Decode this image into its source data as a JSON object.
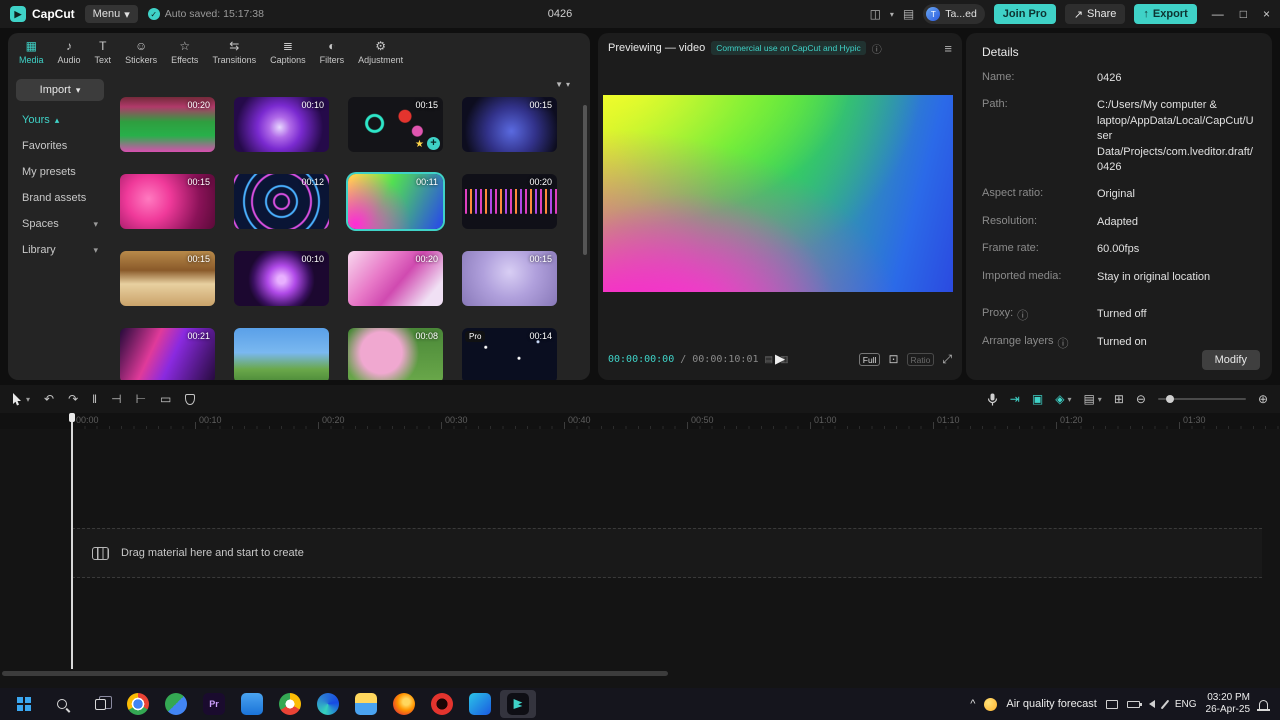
{
  "accent": "#3fd2c7",
  "icons": {
    "check": "✓",
    "chevron_down": "▾",
    "chevron_up": "▴",
    "share_arrow": "↗",
    "export_arrow": "↑",
    "minimize": "—",
    "maximize": "□",
    "close": "×",
    "hamburger": "≡",
    "info": "ⓘ",
    "play": "▶",
    "undo": "↶",
    "redo": "↷",
    "split": "‖",
    "trim_left": "⊣",
    "trim_right": "⊢",
    "delete": "▭",
    "zoom_out": "⊖",
    "zoom_in": "⊕",
    "crop": "⊡",
    "expand": "⤢",
    "filter": "▼",
    "star": "★",
    "plus": "+",
    "layout": "◫",
    "keyboard": "▤",
    "magnet": "⇥",
    "link": "▣",
    "keyframe": "◈",
    "tracks": "▤",
    "screen": "⊞",
    "caret_up": "^",
    "grid_a": "▤",
    "grid_b": "▥",
    "logo_play": "▶"
  },
  "titlebar": {
    "app_name": "CapCut",
    "menu_label": "Menu",
    "autosave_text": "Auto saved: 15:17:38",
    "project_title": "0426",
    "user_initial": "T",
    "user_name": "Ta...ed",
    "join_pro_label": "Join Pro",
    "share_label": "Share",
    "export_label": "Export"
  },
  "media_tabs": [
    {
      "label": "Media",
      "icon": "▦"
    },
    {
      "label": "Audio",
      "icon": "♪"
    },
    {
      "label": "Text",
      "icon": "T"
    },
    {
      "label": "Stickers",
      "icon": "☺"
    },
    {
      "label": "Effects",
      "icon": "☆"
    },
    {
      "label": "Transitions",
      "icon": "⇆"
    },
    {
      "label": "Captions",
      "icon": "≣"
    },
    {
      "label": "Filters",
      "icon": "◐"
    },
    {
      "label": "Adjustment",
      "icon": "⚙"
    }
  ],
  "sidebar": {
    "import_label": "Import",
    "yours_label": "Yours",
    "favorites_label": "Favorites",
    "presets_label": "My presets",
    "brand_label": "Brand assets",
    "spaces_label": "Spaces",
    "library_label": "Library"
  },
  "media_grid": {
    "items": [
      {
        "name": "stadium-clip",
        "duration": "00:20",
        "bg": "background:linear-gradient(180deg,#742a3a 0%,#b03a6a 18%,#2f9e3f 45%,#27b04a 70%,#d84fb0 100%)"
      },
      {
        "name": "purple-flare-clip",
        "duration": "00:10",
        "bg": "background:radial-gradient(circle at 48% 55%,#e8d8ff 0%,#b06ae8 18%,#7a2ad0 38%,#250a4a 75%)"
      },
      {
        "name": "neon-circles-clip",
        "duration": "00:15",
        "bg": "background:radial-gradient(circle at 28% 48%,rgba(0,0,0,0) 0 6px,#2ee6c8 7px 9px,rgba(0,0,0,0) 10px),radial-gradient(circle at 60% 35%,#e3342e 0 6px,rgba(0,0,0,0) 7px),radial-gradient(circle at 73% 62%,#e055b0 0 5px,rgba(0,0,0,0) 6px),linear-gradient(#141418,#141418)"
      },
      {
        "name": "hand-hologram-clip",
        "duration": "00:15",
        "bg": "background:radial-gradient(circle at 52% 62%,#5a6ae0 0%,#32328a 40%,#0d0d1f 78%)"
      },
      {
        "name": "heart-bokeh-clip",
        "duration": "00:15",
        "bg": "background:radial-gradient(circle at 30% 45%,#ff7ac0 0%,#f03a9a 30%,#8a1258 70%,#5a0a38 100%)"
      },
      {
        "name": "neon-tunnel-clip",
        "duration": "00:12",
        "bg": "background:repeating-radial-gradient(circle at 50% 50%,#0a1535 0 6px,#d84fe0 7px 8px,#0a1535 9px 14px,#4ab0ff 15px 16px,#0a1535 17px 22px)"
      },
      {
        "name": "color-gradient-clip",
        "duration": "00:11",
        "bg": "background:radial-gradient(circle at 8% 92%,#ff2bd6 0%,rgba(255,43,214,0) 55%),linear-gradient(115deg,#ffe93b 5%,#52e052 40%,#2b52e0 95%)"
      },
      {
        "name": "audio-spectrum-clip",
        "duration": "00:20",
        "bg": "background:repeating-linear-gradient(90deg,rgba(0,0,0,0) 0 3px,#e040c0 3px 5px,rgba(0,0,0,0) 5px 8px,#ff8a3c 8px 10px,rgba(0,0,0,0) 10px 13px,#b04ae8 13px 15px) center / 100% 45% no-repeat,linear-gradient(#101018,#101018)"
      },
      {
        "name": "noodles-clip",
        "duration": "00:15",
        "bg": "background:linear-gradient(180deg,#b88a4a 0%,#8a5a2a 35%,#e8d0a0 60%,#caa36a 100%)"
      },
      {
        "name": "neon-heart-clip",
        "duration": "00:10",
        "bg": "background:radial-gradient(circle at 50% 52%,#e8b0ff 0 4px,#b04ae8 14px,#3a1060 28px,#1c0830 60%)"
      },
      {
        "name": "pink-fluid-clip",
        "duration": "00:20",
        "bg": "background:linear-gradient(130deg,#f8d8ee 0%,#e87ac8 35%,#d04ab0 55%,#f0e0f4 85%)"
      },
      {
        "name": "lavender-blur-clip",
        "duration": "00:15",
        "bg": "background:radial-gradient(circle at 50% 38%,#d8cef4 0%,#b0a0dc 45%,#8878b8 100%)"
      },
      {
        "name": "neon-lines-clip",
        "duration": "00:21",
        "bg": "background:linear-gradient(115deg,#240a3a 0%,#e03a9a 35%,#8a2ae0 55%,#240a3a 100%)"
      },
      {
        "name": "spring-flowers-clip",
        "duration": "",
        "bg": "background:linear-gradient(180deg,#5aa0e8 0%,#7ab8f0 45%,#6aa84a 75%,#4a8838 100%)"
      },
      {
        "name": "blossom-clip",
        "duration": "00:08",
        "bg": "background:radial-gradient(circle at 35% 45%,#f0a8d0 0 30%,rgba(0,0,0,0) 55%),linear-gradient(180deg,#4a8838 0%,#6aa84a 100%)"
      },
      {
        "name": "starry-pro-clip",
        "duration": "00:14",
        "pro": "Pro",
        "bg": "background:radial-gradient(circle at 25% 35%,#fff 0 1px,rgba(0,0,0,0) 2px),radial-gradient(circle at 60% 55%,#fff 0 1px,rgba(0,0,0,0) 2px),radial-gradient(circle at 80% 25%,#cfe0ff 0 1px,rgba(0,0,0,0) 2px),linear-gradient(#0a0e20,#0a0e20)"
      }
    ]
  },
  "preview": {
    "title": "Previewing — video",
    "badge": "Commercial use on CapCut and Hypic",
    "current_time": "00:00:00:00",
    "separator": "/",
    "total_time": "00:00:10:01",
    "full_label": "Full",
    "ratio_label": "Ratio",
    "canvas_bg": "background:radial-gradient(ellipse at 0% 115%,#ff1fd4 0%,rgba(255,31,212,0) 60%),radial-gradient(ellipse at 25% 115%,#ff4fd0 0%,rgba(255,79,208,0) 40%),radial-gradient(ellipse at 2% -10%,#f6ff2b 0%,rgba(246,255,43,0) 50%),radial-gradient(ellipse at 45% -15%,#35e83a 0%,rgba(53,232,58,0) 60%),linear-gradient(105deg,#bfe82b 0%,#3ce04a 35%,#2b6ae8 85%,#2b4ae0 100%)"
  },
  "details": {
    "title": "Details",
    "rows": [
      {
        "label": "Name:",
        "value": "0426"
      },
      {
        "label": "Path:",
        "value": "C:/Users/My computer & laptop/AppData/Local/CapCut/User Data/Projects/com.lveditor.draft/0426"
      },
      {
        "label": "Aspect ratio:",
        "value": "Original"
      },
      {
        "label": "Resolution:",
        "value": "Adapted"
      },
      {
        "label": "Frame rate:",
        "value": "60.00fps"
      },
      {
        "label": "Imported media:",
        "value": "Stay in original location"
      },
      {
        "label": "Proxy:",
        "value": "Turned off"
      },
      {
        "label": "Arrange layers",
        "value": "Turned on"
      }
    ],
    "modify_label": "Modify"
  },
  "timeline": {
    "ruler_labels": [
      "00:00",
      "00:10",
      "00:20",
      "00:30",
      "00:40",
      "00:50",
      "01:00",
      "01:10",
      "01:20",
      "01:30"
    ],
    "drag_hint": "Drag material here and start to create"
  },
  "taskbar": {
    "weather_label": "Air quality forecast",
    "language": "ENG",
    "time": "03:20 PM",
    "date": "26-Apr-25",
    "apps": [
      {
        "name": "chrome-icon",
        "bg": "background:radial-gradient(circle at 50% 50%,#4285f4 0 30%,#fff 31% 40%,rgba(0,0,0,0) 41%),conic-gradient(#ea4335 0 33%,#34a853 0 66%,#fbbc05 0)"
      },
      {
        "name": "maps-icon",
        "bg": "background:linear-gradient(135deg,#34a853 0 50%,#4285f4 50%)"
      },
      {
        "name": "premiere-icon",
        "bg": "background:#1a0b2e",
        "label": "Pr"
      },
      {
        "name": "mail-icon",
        "bg": "background:linear-gradient(180deg,#4aa3f0,#1a73d8)"
      },
      {
        "name": "chrome-profile-icon",
        "bg": "background:radial-gradient(circle at 50% 50%,#fff 0 28%,rgba(0,0,0,0) 29%),conic-gradient(#fbbc05 0 33%,#ea4335 0 66%,#34a853 0)"
      },
      {
        "name": "edge-icon",
        "bg": "background:conic-gradient(from 200deg,#35d2bc,#2b7cd3,#174ae4,#35d2bc)"
      },
      {
        "name": "file-explorer-icon",
        "bg": "background:linear-gradient(180deg,#ffd75e 0 45%,#4aa3f0 45%)"
      },
      {
        "name": "firefox-icon",
        "bg": "background:radial-gradient(circle at 60% 40%,#ffd75e 0 18%,#ff9500 45%,#e33b2e 80%)"
      },
      {
        "name": "opera-icon",
        "bg": "background:radial-gradient(circle at 50% 50%,#1a0505 0 35%,#e3342e 36%)"
      },
      {
        "name": "video-app-icon",
        "bg": "background:linear-gradient(135deg,#2bc4e8,#1a5ae0)"
      },
      {
        "name": "capcut-icon",
        "bg": "background:#0e0e14"
      }
    ]
  }
}
